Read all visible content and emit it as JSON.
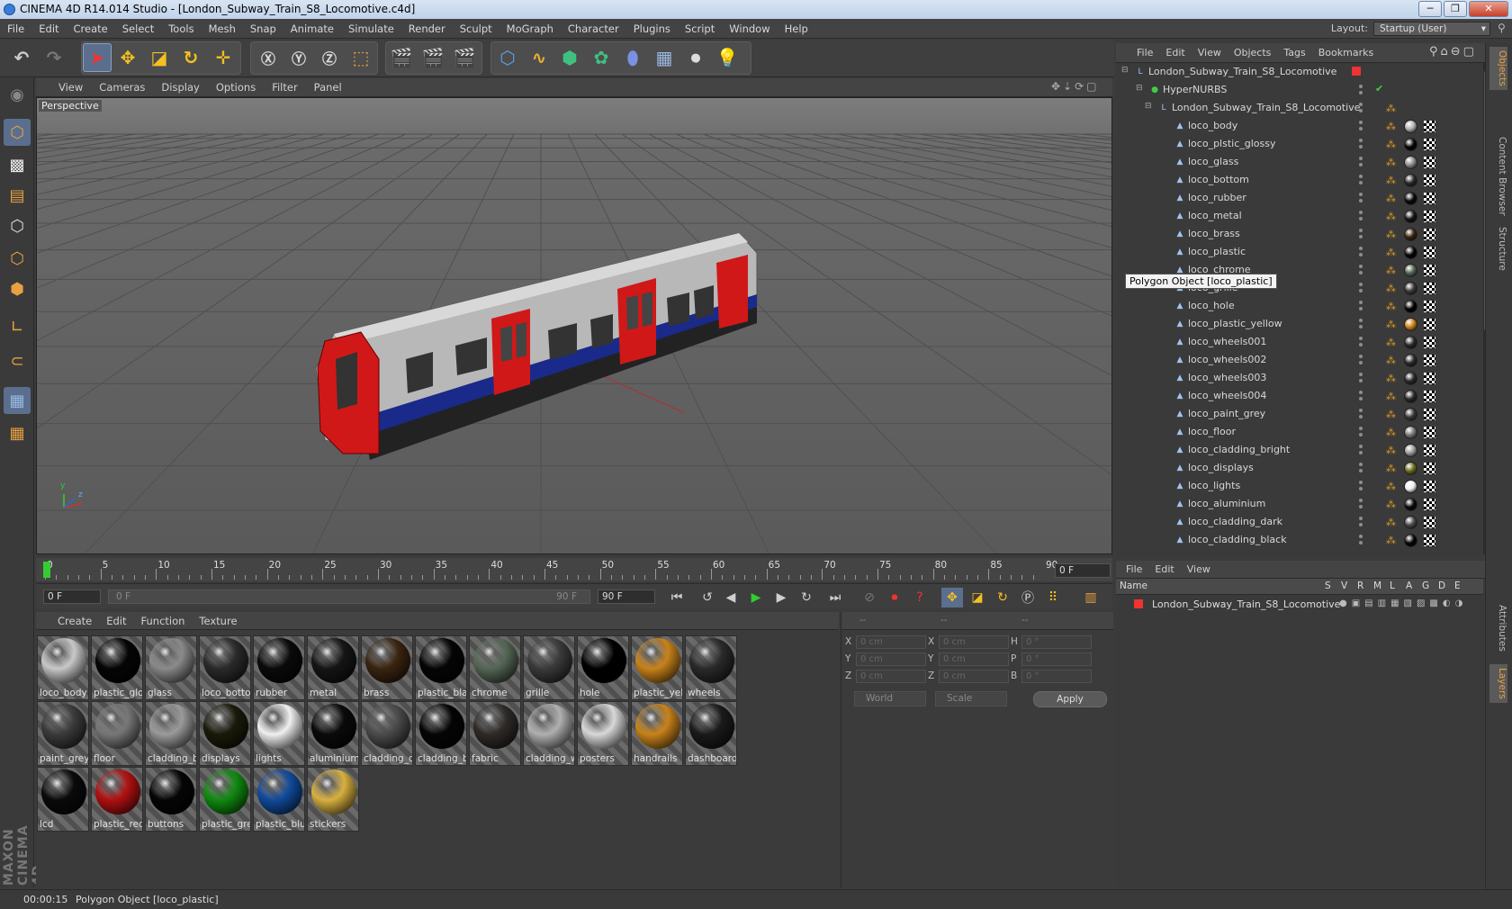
{
  "window": {
    "title": "CINEMA 4D R14.014 Studio - [London_Subway_Train_S8_Locomotive.c4d]",
    "min_label": "─",
    "max_label": "❐",
    "close_label": "✕"
  },
  "menu": [
    "File",
    "Edit",
    "Create",
    "Select",
    "Tools",
    "Mesh",
    "Snap",
    "Animate",
    "Simulate",
    "Render",
    "Sculpt",
    "MoGraph",
    "Character",
    "Plugins",
    "Script",
    "Window",
    "Help"
  ],
  "layout": {
    "label": "Layout:",
    "value": "Startup (User)"
  },
  "viewport": {
    "menu": [
      "View",
      "Cameras",
      "Display",
      "Options",
      "Filter",
      "Panel"
    ],
    "label": "Perspective",
    "axis_y": "y",
    "axis_z": "z"
  },
  "timeline": {
    "ticks": [
      "0",
      "5",
      "10",
      "15",
      "20",
      "25",
      "30",
      "35",
      "40",
      "45",
      "50",
      "55",
      "60",
      "65",
      "70",
      "75",
      "80",
      "85",
      "90"
    ],
    "current_frame": "0 F",
    "start_field": "0 F",
    "range_start": "0 F",
    "range_end": "90 F",
    "end_field": "90 F"
  },
  "materials": {
    "menu": [
      "Create",
      "Edit",
      "Function",
      "Texture"
    ],
    "items": [
      {
        "label": "loco_body",
        "color": "#c8c8c8"
      },
      {
        "label": "plastic_glo",
        "color": "#050505"
      },
      {
        "label": "glass",
        "color": "#8a8a8a"
      },
      {
        "label": "loco_botto",
        "color": "#2a2a2a"
      },
      {
        "label": "rubber",
        "color": "#0a0a0a"
      },
      {
        "label": "metal",
        "color": "#151515"
      },
      {
        "label": "brass",
        "color": "#3a2410"
      },
      {
        "label": "plastic_bla",
        "color": "#050505"
      },
      {
        "label": "chrome",
        "color": "#556655"
      },
      {
        "label": "grille",
        "color": "#3a3a3a"
      },
      {
        "label": "hole",
        "color": "#000000"
      },
      {
        "label": "plastic_yell",
        "color": "#c8821a"
      },
      {
        "label": "wheels",
        "color": "#2a2a2a"
      },
      {
        "label": "paint_grey",
        "color": "#3a3a3a"
      },
      {
        "label": "floor",
        "color": "#777777"
      },
      {
        "label": "cladding_b",
        "color": "#9a9a9a"
      },
      {
        "label": "displays",
        "color": "#1a1a0a"
      },
      {
        "label": "lights",
        "color": "#f0f0f0"
      },
      {
        "label": "aluminium",
        "color": "#0a0a0a"
      },
      {
        "label": "cladding_d",
        "color": "#4a4a4a"
      },
      {
        "label": "cladding_b",
        "color": "#050505"
      },
      {
        "label": "fabric",
        "color": "#2e2a28"
      },
      {
        "label": "cladding_w",
        "color": "#b0b0b0"
      },
      {
        "label": "posters",
        "color": "#d8d8d8"
      },
      {
        "label": "handrails",
        "color": "#c8821a"
      },
      {
        "label": "dashboard",
        "color": "#1a1a1a"
      },
      {
        "label": "lcd",
        "color": "#0a0a0a"
      },
      {
        "label": "plastic_red",
        "color": "#b01010"
      },
      {
        "label": "buttons",
        "color": "#050505"
      },
      {
        "label": "plastic_gre",
        "color": "#108a10"
      },
      {
        "label": "plastic_blu",
        "color": "#104a9a"
      },
      {
        "label": "stickers",
        "color": "#d8b040"
      }
    ]
  },
  "coordinates": {
    "header": [
      "--",
      "--",
      "--"
    ],
    "rows": [
      {
        "a": "X",
        "av": "0 cm",
        "b": "X",
        "bv": "0 cm",
        "c": "H",
        "cv": "0 °"
      },
      {
        "a": "Y",
        "av": "0 cm",
        "b": "Y",
        "bv": "0 cm",
        "c": "P",
        "cv": "0 °"
      },
      {
        "a": "Z",
        "av": "0 cm",
        "b": "Z",
        "bv": "0 cm",
        "c": "B",
        "cv": "0 °"
      }
    ],
    "space": "World",
    "mode": "Scale",
    "apply": "Apply"
  },
  "objects_panel": {
    "menu": [
      "File",
      "Edit",
      "View",
      "Objects",
      "Tags",
      "Bookmarks"
    ],
    "items": [
      {
        "name": "London_Subway_Train_S8_Locomotive",
        "level": 0,
        "type": "null"
      },
      {
        "name": "HyperNURBS",
        "level": 1,
        "type": "nurbs"
      },
      {
        "name": "London_Subway_Train_S8_Locomotive",
        "level": 2,
        "type": "null"
      },
      {
        "name": "loco_body",
        "level": 3,
        "type": "poly",
        "mat": "#b0b0b0"
      },
      {
        "name": "loco_plstic_glossy",
        "level": 3,
        "type": "poly",
        "mat": "#050505"
      },
      {
        "name": "loco_glass",
        "level": 3,
        "type": "poly",
        "mat": "#8a8a8a"
      },
      {
        "name": "loco_bottom",
        "level": 3,
        "type": "poly",
        "mat": "#2a2a2a"
      },
      {
        "name": "loco_rubber",
        "level": 3,
        "type": "poly",
        "mat": "#0a0a0a"
      },
      {
        "name": "loco_metal",
        "level": 3,
        "type": "poly",
        "mat": "#151515"
      },
      {
        "name": "loco_brass",
        "level": 3,
        "type": "poly",
        "mat": "#3a2410"
      },
      {
        "name": "loco_plastic",
        "level": 3,
        "type": "poly",
        "mat": "#050505"
      },
      {
        "name": "loco_chrome",
        "level": 3,
        "type": "poly",
        "mat": "#556655"
      },
      {
        "name": "loco_grille",
        "level": 3,
        "type": "poly",
        "mat": "#3a3a3a"
      },
      {
        "name": "loco_hole",
        "level": 3,
        "type": "poly",
        "mat": "#000000"
      },
      {
        "name": "loco_plastic_yellow",
        "level": 3,
        "type": "poly",
        "mat": "#c8821a"
      },
      {
        "name": "loco_wheels001",
        "level": 3,
        "type": "poly",
        "mat": "#2a2a2a"
      },
      {
        "name": "loco_wheels002",
        "level": 3,
        "type": "poly",
        "mat": "#2a2a2a"
      },
      {
        "name": "loco_wheels003",
        "level": 3,
        "type": "poly",
        "mat": "#2a2a2a"
      },
      {
        "name": "loco_wheels004",
        "level": 3,
        "type": "poly",
        "mat": "#2a2a2a"
      },
      {
        "name": "loco_paint_grey",
        "level": 3,
        "type": "poly",
        "mat": "#3a3a3a"
      },
      {
        "name": "loco_floor",
        "level": 3,
        "type": "poly",
        "mat": "#777777"
      },
      {
        "name": "loco_cladding_bright",
        "level": 3,
        "type": "poly",
        "mat": "#9a9a9a"
      },
      {
        "name": "loco_displays",
        "level": 3,
        "type": "poly",
        "mat": "#6a6a20"
      },
      {
        "name": "loco_lights",
        "level": 3,
        "type": "poly",
        "mat": "#f0f0f0"
      },
      {
        "name": "loco_aluminium",
        "level": 3,
        "type": "poly",
        "mat": "#0a0a0a"
      },
      {
        "name": "loco_cladding_dark",
        "level": 3,
        "type": "poly",
        "mat": "#4a4a4a"
      },
      {
        "name": "loco_cladding_black",
        "level": 3,
        "type": "poly",
        "mat": "#050505"
      }
    ],
    "tooltip": "Polygon Object [loco_plastic]"
  },
  "layers_panel": {
    "menu": [
      "File",
      "Edit",
      "View"
    ],
    "columns": [
      "Name",
      "S",
      "V",
      "R",
      "M",
      "L",
      "A",
      "G",
      "D",
      "E"
    ],
    "row": "London_Subway_Train_S8_Locomotive"
  },
  "side_tabs": [
    "Objects",
    "Content Browser",
    "Structure",
    "Attributes",
    "Layers"
  ],
  "brand": "MAXON CINEMA 4D",
  "status": {
    "time": "00:00:15",
    "message": "Polygon Object [loco_plastic]"
  },
  "colors": {
    "accent": "#5a6f8e",
    "train_red": "#d01818",
    "train_blue": "#1a2a8a"
  }
}
